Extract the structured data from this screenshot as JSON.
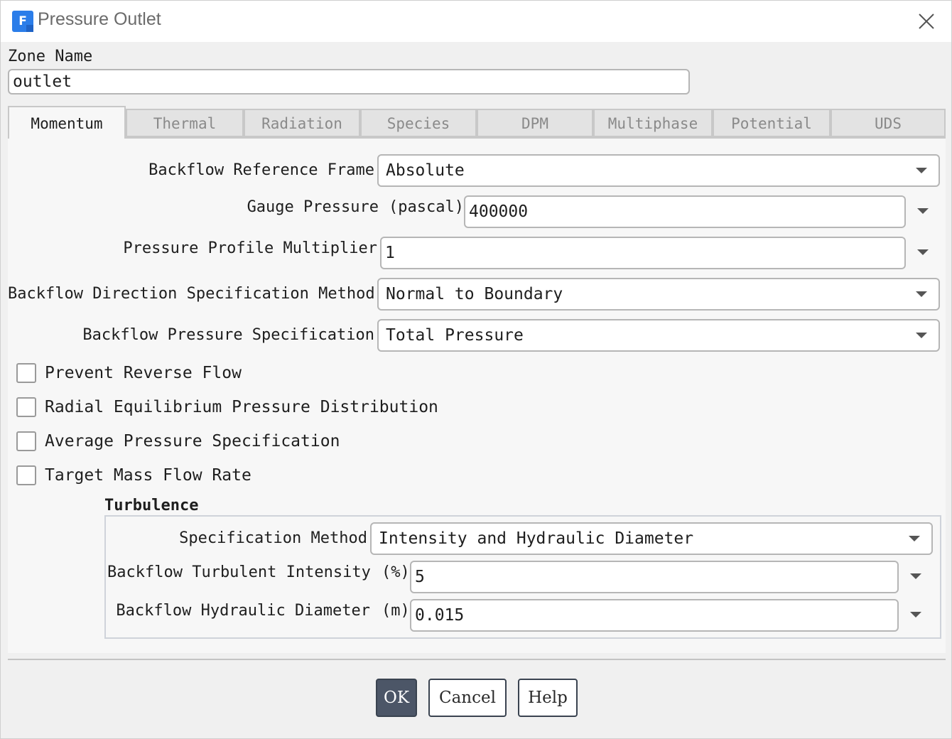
{
  "window": {
    "title": "Pressure Outlet",
    "app_icon_letter": "F"
  },
  "zone": {
    "label": "Zone Name",
    "value": "outlet"
  },
  "tabs": [
    {
      "label": "Momentum",
      "active": true
    },
    {
      "label": "Thermal"
    },
    {
      "label": "Radiation"
    },
    {
      "label": "Species"
    },
    {
      "label": "DPM"
    },
    {
      "label": "Multiphase"
    },
    {
      "label": "Potential"
    },
    {
      "label": "UDS"
    }
  ],
  "momentum": {
    "backflow_reference_frame": {
      "label": "Backflow Reference Frame",
      "value": "Absolute"
    },
    "gauge_pressure": {
      "label": "Gauge Pressure",
      "unit": "(pascal)",
      "value": "400000"
    },
    "pressure_profile_multiplier": {
      "label": "Pressure Profile Multiplier",
      "value": "1"
    },
    "backflow_direction_method": {
      "label": "Backflow Direction Specification Method",
      "value": "Normal to Boundary"
    },
    "backflow_pressure_spec": {
      "label": "Backflow Pressure Specification",
      "value": "Total Pressure"
    },
    "checkboxes": [
      {
        "label": "Prevent Reverse Flow",
        "checked": false
      },
      {
        "label": "Radial Equilibrium Pressure Distribution",
        "checked": false
      },
      {
        "label": "Average Pressure Specification",
        "checked": false
      },
      {
        "label": "Target Mass Flow Rate",
        "checked": false
      }
    ]
  },
  "turbulence": {
    "title": "Turbulence",
    "specification_method": {
      "label": "Specification Method",
      "value": "Intensity and Hydraulic Diameter"
    },
    "backflow_turbulent_intensity": {
      "label": "Backflow Turbulent Intensity",
      "unit": "(%)",
      "value": "5"
    },
    "backflow_hydraulic_diameter": {
      "label": "Backflow Hydraulic Diameter",
      "unit": "(m)",
      "value": "0.015"
    }
  },
  "buttons": {
    "ok": "OK",
    "cancel": "Cancel",
    "help": "Help"
  }
}
